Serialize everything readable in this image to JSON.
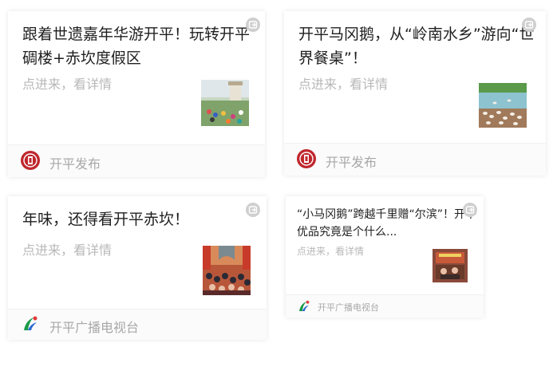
{
  "cards": [
    {
      "title": "跟着世遗嘉年华游开平！玩转开平碉楼+赤坎度假区",
      "subtitle": "点进来，看详情",
      "source": "开平发布",
      "source_logo": "kaiping-fabu-logo"
    },
    {
      "title": "开平马冈鹅，从“岭南水乡”游向“世界餐桌”！",
      "subtitle": "点进来，看详情",
      "source": "开平发布",
      "source_logo": "kaiping-fabu-logo"
    },
    {
      "title": "年味，还得看开平赤坎！",
      "subtitle": "点进来，看详情",
      "source": "开平广播电视台",
      "source_logo": "kaiping-tv-logo"
    },
    {
      "title": "“小马冈鹅”跨越千里赠“尔滨”！开平优品究竟是个什么...",
      "subtitle": "点进来，看详情",
      "source": "开平广播电视台",
      "source_logo": "kaiping-tv-logo"
    }
  ],
  "colors": {
    "title": "#1f1f1f",
    "subtitle": "#b8b8b8",
    "source": "#a8a8a8",
    "badge": "#cfcfcf",
    "fabu_logo": "#c0262d"
  },
  "icons": {
    "badge": "link-badge-icon"
  }
}
